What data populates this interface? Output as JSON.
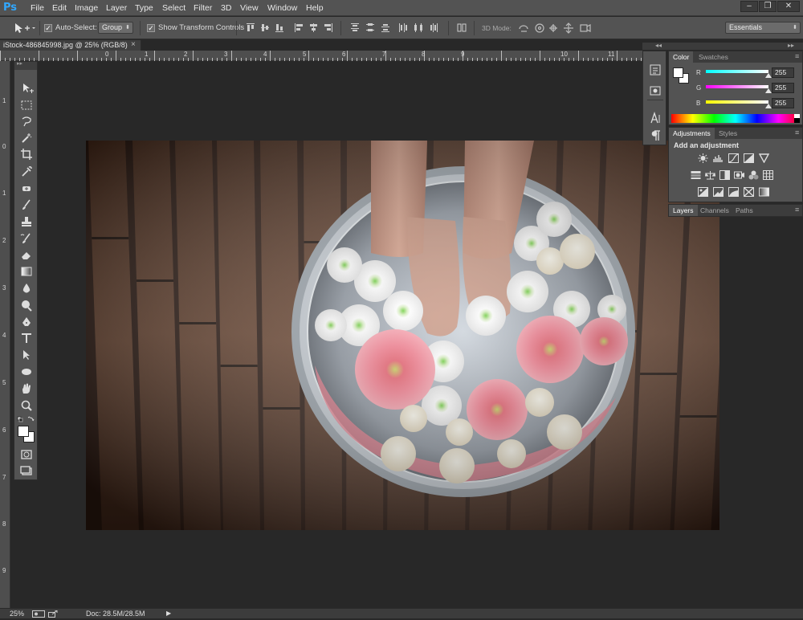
{
  "app": {
    "logo": "Ps"
  },
  "menu": {
    "items": [
      "File",
      "Edit",
      "Image",
      "Layer",
      "Type",
      "Select",
      "Filter",
      "3D",
      "View",
      "Window",
      "Help"
    ]
  },
  "window_controls": {
    "minimize": "–",
    "restore": "❐",
    "close": "✕"
  },
  "options": {
    "tool_icon": "move-tool-icon",
    "auto_select_label": "Auto-Select:",
    "auto_select_checked": "✓",
    "group_value": "Group",
    "transform_label": "Show Transform Controls",
    "transform_checked": "✓",
    "mode_3d_label": "3D Mode:",
    "workspace_value": "Essentials"
  },
  "document": {
    "tab_label": "iStock-486845998.jpg @ 25% (RGB/8)",
    "close": "×"
  },
  "ruler_top": [
    "0",
    "1",
    "2",
    "3",
    "4",
    "5",
    "6",
    "7",
    "8",
    "9",
    "10",
    "11"
  ],
  "ruler_left": [
    "1",
    "0",
    "1",
    "2",
    "3",
    "4",
    "5",
    "6",
    "7",
    "8",
    "9"
  ],
  "color_panel": {
    "tabs": [
      "Color",
      "Swatches"
    ],
    "channels": [
      {
        "label": "R",
        "value": "255",
        "gradient": [
          "#00ffff",
          "#ffffff"
        ]
      },
      {
        "label": "G",
        "value": "255",
        "gradient": [
          "#ff00ff",
          "#ffffff"
        ]
      },
      {
        "label": "B",
        "value": "255",
        "gradient": [
          "#ffff00",
          "#ffffff"
        ]
      }
    ]
  },
  "adjustments_panel": {
    "tabs": [
      "Adjustments",
      "Styles"
    ],
    "heading": "Add an adjustment"
  },
  "layers_panel": {
    "tabs": [
      "Layers",
      "Channels",
      "Paths"
    ]
  },
  "status": {
    "zoom": "25%",
    "doc": "Doc: 28.5M/28.5M",
    "arrow": "▶"
  },
  "colors": {
    "accent": "#31a8ff",
    "ui_bg": "#535353",
    "canvas_bg": "#282828"
  }
}
